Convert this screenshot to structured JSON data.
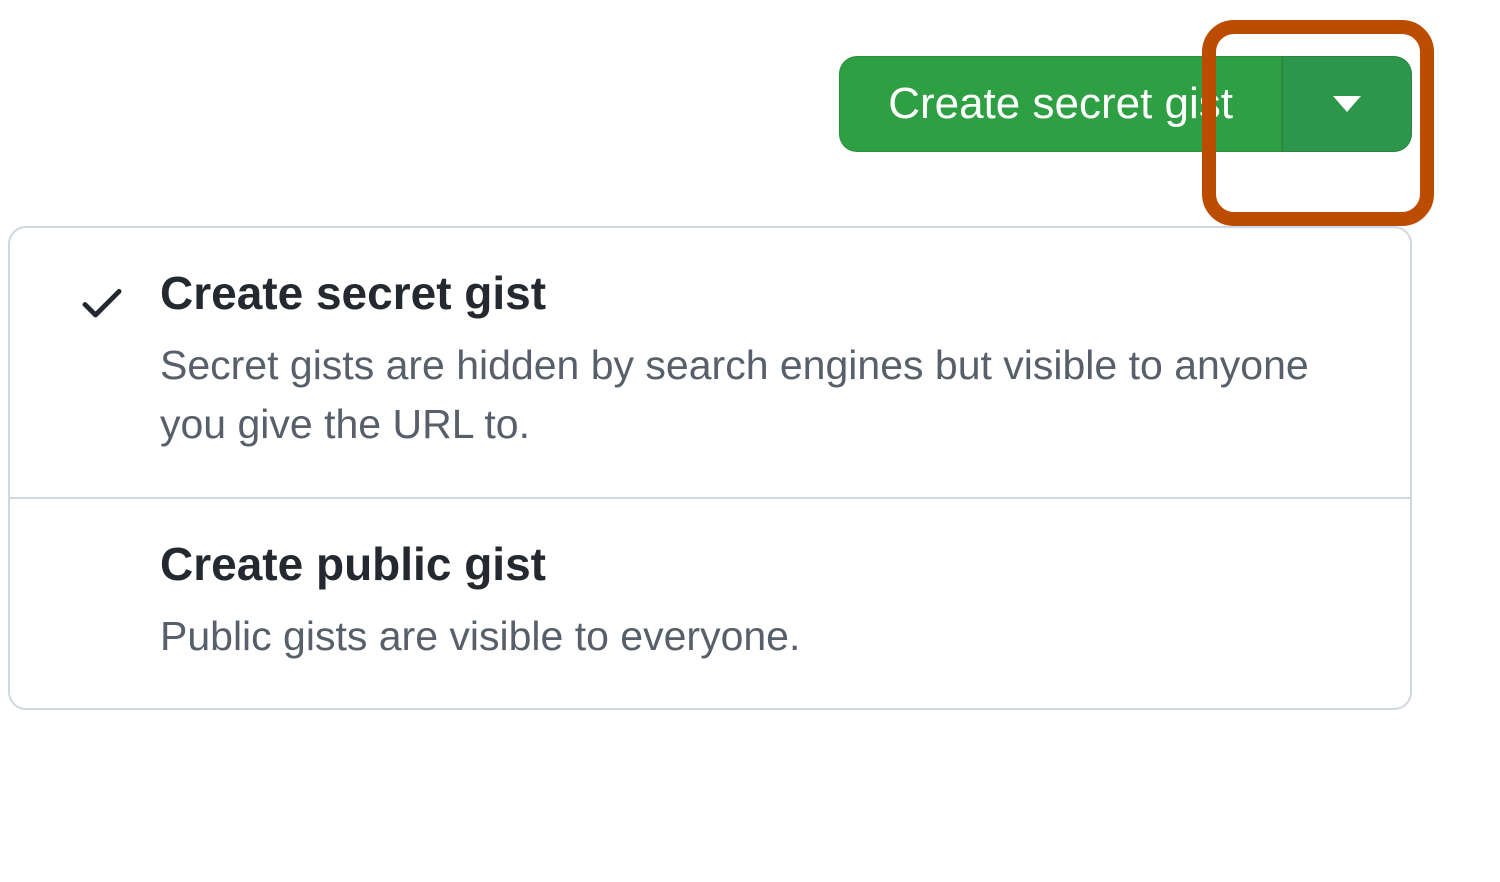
{
  "button": {
    "label": "Create secret gist"
  },
  "menu": {
    "items": [
      {
        "title": "Create secret gist",
        "description": "Secret gists are hidden by search engines but visible to anyone you give the URL to.",
        "selected": true
      },
      {
        "title": "Create public gist",
        "description": "Public gists are visible to everyone.",
        "selected": false
      }
    ]
  },
  "colors": {
    "button_bg": "#2ea043",
    "dropdown_bg": "#2c974b",
    "highlight": "#bc4c00",
    "text_primary": "#24292f",
    "text_secondary": "#57606a",
    "border": "#d0d7de"
  }
}
